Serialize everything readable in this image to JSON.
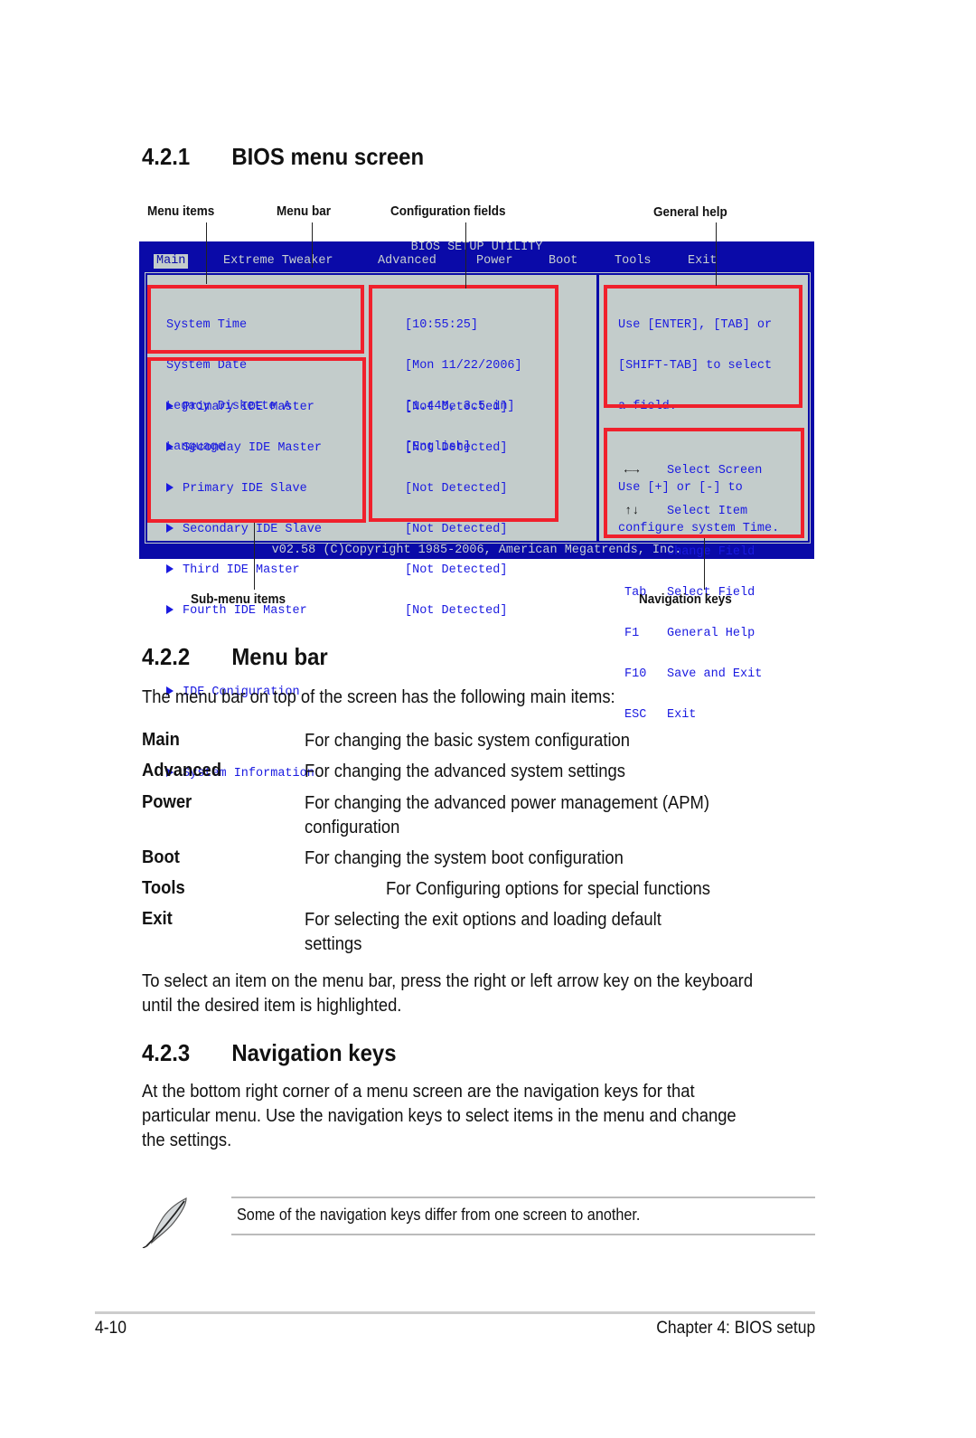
{
  "sections": {
    "s421": {
      "number": "4.2.1",
      "title": "BIOS menu screen"
    },
    "s422": {
      "number": "4.2.2",
      "title": "Menu bar"
    },
    "s423": {
      "number": "4.2.3",
      "title": "Navigation keys"
    }
  },
  "callouts": {
    "menu_items": "Menu items",
    "menu_bar": "Menu bar",
    "configuration_fields": "Configuration fields",
    "general_help": "General help",
    "sub_menu_items": "Sub-menu items",
    "navigation_keys": "Navigation keys"
  },
  "bios": {
    "title": "BIOS SETUP UTILITY",
    "menu": [
      "Main",
      "Extreme Tweaker",
      "Advanced",
      "Power",
      "Boot",
      "Tools",
      "Exit"
    ],
    "active_menu": "Main",
    "items": [
      {
        "label": "System Time",
        "value": "[10:55:25]"
      },
      {
        "label": "System Date",
        "value": "[Mon 11/22/2006]"
      },
      {
        "label": "Legacy Diskette A",
        "value": "[1.44M, 3.5 in]"
      },
      {
        "label": "Language",
        "value": "[English]"
      }
    ],
    "submenus": [
      {
        "label": "Primary IDE Master",
        "value": "[Not Detected]"
      },
      {
        "label": "Seconday IDE Master",
        "value": "[Not Detected]"
      },
      {
        "label": "Primary IDE Slave",
        "value": "[Not Detected]"
      },
      {
        "label": "Secondary IDE Slave",
        "value": "[Not Detected]"
      },
      {
        "label": "Third IDE Master",
        "value": "[Not Detected]"
      },
      {
        "label": "Fourth IDE Master",
        "value": "[Not Detected]"
      },
      {
        "label": "IDE Coniguration"
      },
      {
        "label": "System Information"
      }
    ],
    "help": {
      "line1": "Use [ENTER], [TAB] or",
      "line2": "[SHIFT-TAB] to select",
      "line3": "a field.",
      "line4": "Use [+] or [-] to",
      "line5": "configure system Time."
    },
    "nav_keys": [
      {
        "key": "←→",
        "action": "Select Screen"
      },
      {
        "key": "↑↓",
        "action": "Select Item"
      },
      {
        "key": "+-",
        "action": "Change Field"
      },
      {
        "key": "Tab",
        "action": "Select Field"
      },
      {
        "key": "F1",
        "action": "General Help"
      },
      {
        "key": "F10",
        "action": "Save and Exit"
      },
      {
        "key": "ESC",
        "action": "Exit"
      }
    ],
    "footer": "v02.58 (C)Copyright 1985-2006, American Megatrends, Inc.",
    "colors": {
      "frame": "#0a0aa8",
      "panel": "#c3cccb",
      "text": "#1a1ae0",
      "highlight": "#f0202c"
    }
  },
  "menu_bar_intro": "The menu bar on top of the screen has the following main items:",
  "menu_defs": [
    {
      "term": "Main",
      "desc": "For changing the basic system configuration"
    },
    {
      "term": "Advanced",
      "desc": "For changing the advanced system settings"
    },
    {
      "term": "Power",
      "desc": "For changing the advanced power management (APM)",
      "desc2": "configuration"
    },
    {
      "term": "Boot",
      "desc": "For changing the system boot configuration"
    },
    {
      "term": "Tools",
      "desc": "For Configuring options for special functions"
    },
    {
      "term": "Exit",
      "desc": "For selecting the exit options and loading default",
      "desc2": "settings"
    }
  ],
  "select_para": {
    "line1": "To select an item on the menu bar, press the right or left arrow key on the keyboard",
    "line2": "until the desired item is highlighted."
  },
  "nav_para": {
    "line1": "At the bottom right corner of a menu screen are the navigation keys for that",
    "line2": "particular menu. Use the navigation keys to select items in the menu and change",
    "line3": "the settings."
  },
  "note": {
    "icon": "feather-pen-icon",
    "text": "Some of the navigation keys differ from one screen to another."
  },
  "footer": {
    "page": "4-10",
    "chapter": "Chapter 4: BIOS setup"
  }
}
